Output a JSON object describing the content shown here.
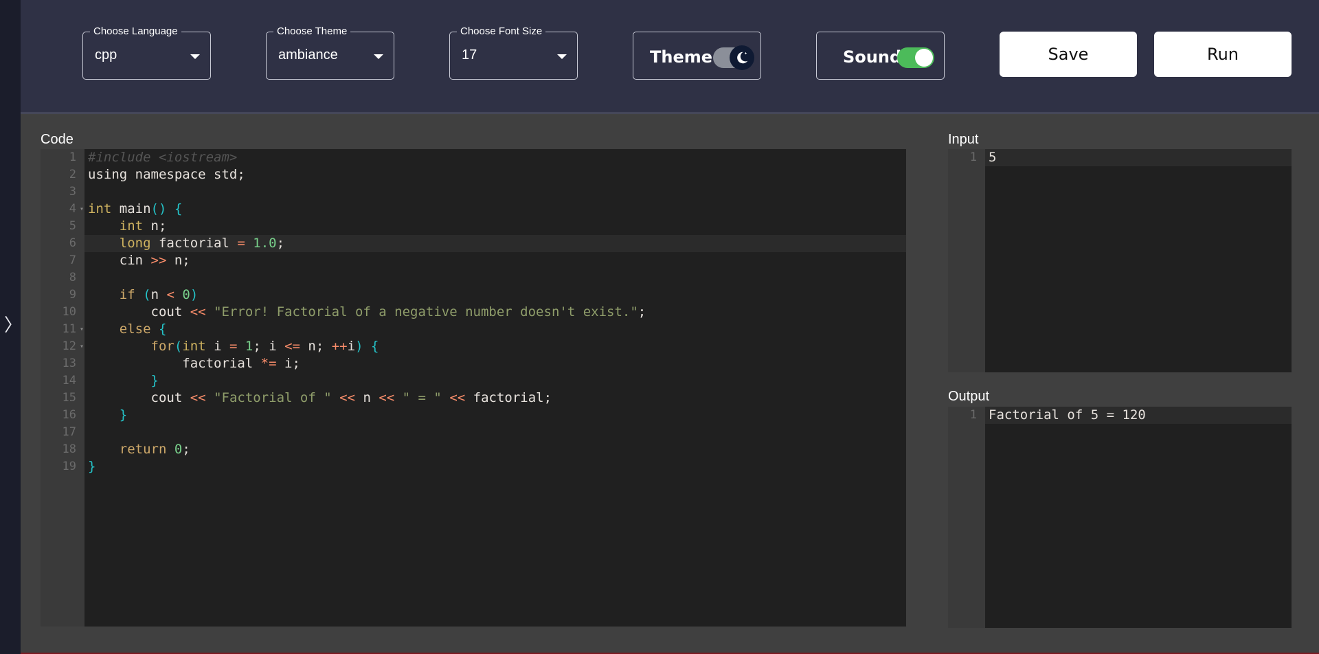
{
  "toolbar": {
    "language": {
      "legend": "Choose Language",
      "value": "cpp"
    },
    "theme": {
      "legend": "Choose Theme",
      "value": "ambiance"
    },
    "font_size": {
      "legend": "Choose Font Size",
      "value": "17"
    },
    "theme_toggle": {
      "label": "Theme",
      "state": "dark"
    },
    "sound_toggle": {
      "label": "Sound",
      "state": "on"
    },
    "save_label": "Save",
    "run_label": "Run"
  },
  "sidebar": {
    "toggle_glyph": "〉"
  },
  "code_panel": {
    "label": "Code",
    "active_line": 6,
    "fold_lines": [
      4,
      11,
      12
    ],
    "lines": [
      [
        {
          "t": "#include <iostream>",
          "c": "comment"
        }
      ],
      [
        {
          "t": "using namespace std;",
          "c": "plain"
        }
      ],
      [],
      [
        {
          "t": "int",
          "c": "type"
        },
        {
          "t": " main",
          "c": "plain"
        },
        {
          "t": "()",
          "c": "paren"
        },
        {
          "t": " ",
          "c": "plain"
        },
        {
          "t": "{",
          "c": "paren"
        }
      ],
      [
        {
          "t": "    ",
          "c": "plain"
        },
        {
          "t": "int",
          "c": "type"
        },
        {
          "t": " n;",
          "c": "plain"
        }
      ],
      [
        {
          "t": "    ",
          "c": "plain"
        },
        {
          "t": "long",
          "c": "type"
        },
        {
          "t": " factorial ",
          "c": "plain"
        },
        {
          "t": "=",
          "c": "op"
        },
        {
          "t": " ",
          "c": "plain"
        },
        {
          "t": "1.0",
          "c": "num"
        },
        {
          "t": ";",
          "c": "plain"
        }
      ],
      [
        {
          "t": "    cin ",
          "c": "plain"
        },
        {
          "t": ">>",
          "c": "op"
        },
        {
          "t": " n;",
          "c": "plain"
        }
      ],
      [],
      [
        {
          "t": "    ",
          "c": "plain"
        },
        {
          "t": "if",
          "c": "kw"
        },
        {
          "t": " ",
          "c": "plain"
        },
        {
          "t": "(",
          "c": "paren"
        },
        {
          "t": "n ",
          "c": "plain"
        },
        {
          "t": "<",
          "c": "op"
        },
        {
          "t": " ",
          "c": "plain"
        },
        {
          "t": "0",
          "c": "num"
        },
        {
          "t": ")",
          "c": "paren"
        }
      ],
      [
        {
          "t": "        cout ",
          "c": "plain"
        },
        {
          "t": "<<",
          "c": "op"
        },
        {
          "t": " ",
          "c": "plain"
        },
        {
          "t": "\"Error! Factorial of a negative number doesn't exist.\"",
          "c": "str"
        },
        {
          "t": ";",
          "c": "plain"
        }
      ],
      [
        {
          "t": "    ",
          "c": "plain"
        },
        {
          "t": "else",
          "c": "kw"
        },
        {
          "t": " ",
          "c": "plain"
        },
        {
          "t": "{",
          "c": "paren"
        }
      ],
      [
        {
          "t": "        ",
          "c": "plain"
        },
        {
          "t": "for",
          "c": "kw"
        },
        {
          "t": "(",
          "c": "paren"
        },
        {
          "t": "int",
          "c": "type"
        },
        {
          "t": " i ",
          "c": "plain"
        },
        {
          "t": "=",
          "c": "op"
        },
        {
          "t": " ",
          "c": "plain"
        },
        {
          "t": "1",
          "c": "num"
        },
        {
          "t": "; i ",
          "c": "plain"
        },
        {
          "t": "<=",
          "c": "op"
        },
        {
          "t": " n; ",
          "c": "plain"
        },
        {
          "t": "++",
          "c": "op"
        },
        {
          "t": "i",
          "c": "plain"
        },
        {
          "t": ")",
          "c": "paren"
        },
        {
          "t": " ",
          "c": "plain"
        },
        {
          "t": "{",
          "c": "paren"
        }
      ],
      [
        {
          "t": "            factorial ",
          "c": "plain"
        },
        {
          "t": "*=",
          "c": "op"
        },
        {
          "t": " i;",
          "c": "plain"
        }
      ],
      [
        {
          "t": "        ",
          "c": "plain"
        },
        {
          "t": "}",
          "c": "paren"
        }
      ],
      [
        {
          "t": "        cout ",
          "c": "plain"
        },
        {
          "t": "<<",
          "c": "op"
        },
        {
          "t": " ",
          "c": "plain"
        },
        {
          "t": "\"Factorial of \"",
          "c": "str"
        },
        {
          "t": " ",
          "c": "plain"
        },
        {
          "t": "<<",
          "c": "op"
        },
        {
          "t": " n ",
          "c": "plain"
        },
        {
          "t": "<<",
          "c": "op"
        },
        {
          "t": " ",
          "c": "plain"
        },
        {
          "t": "\" = \"",
          "c": "str"
        },
        {
          "t": " ",
          "c": "plain"
        },
        {
          "t": "<<",
          "c": "op"
        },
        {
          "t": " factorial;",
          "c": "plain"
        }
      ],
      [
        {
          "t": "    ",
          "c": "plain"
        },
        {
          "t": "}",
          "c": "paren"
        }
      ],
      [],
      [
        {
          "t": "    ",
          "c": "plain"
        },
        {
          "t": "return",
          "c": "kw"
        },
        {
          "t": " ",
          "c": "plain"
        },
        {
          "t": "0",
          "c": "num"
        },
        {
          "t": ";",
          "c": "plain"
        }
      ],
      [
        {
          "t": "}",
          "c": "paren"
        }
      ]
    ]
  },
  "input_panel": {
    "label": "Input",
    "lines": [
      "5"
    ]
  },
  "output_panel": {
    "label": "Output",
    "lines": [
      "Factorial of 5 = 120"
    ]
  },
  "colors": {
    "toolbar_bg": "#2f3145",
    "main_bg": "#404040",
    "editor_bg": "#202020",
    "sound_on": "#4cbb5a",
    "theme_knob": "#0f1a33"
  }
}
